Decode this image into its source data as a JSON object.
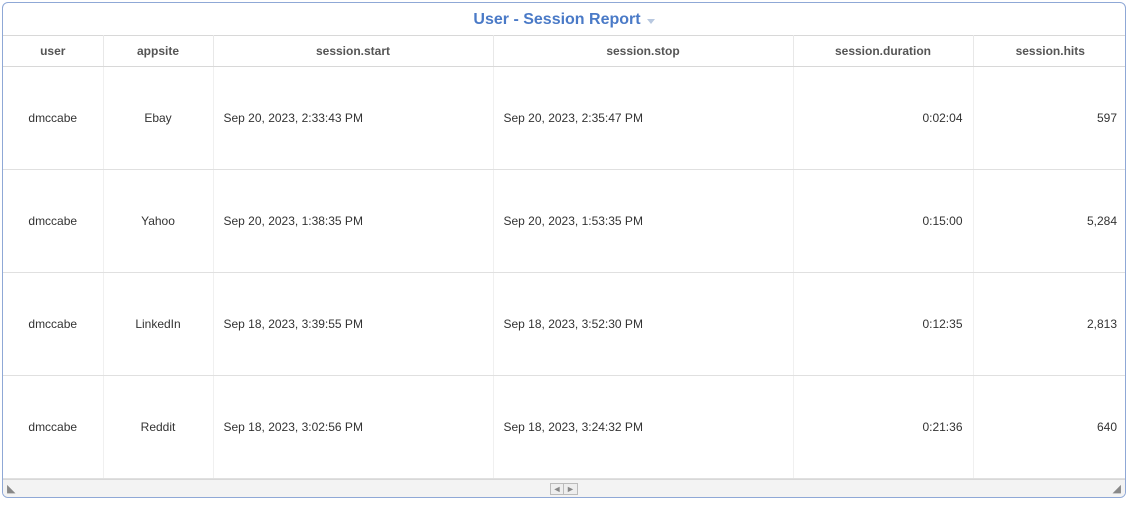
{
  "header": {
    "title": "User - Session Report"
  },
  "columns": {
    "user": "user",
    "appsite": "appsite",
    "start": "session.start",
    "stop": "session.stop",
    "duration": "session.duration",
    "hits": "session.hits"
  },
  "rows": [
    {
      "user": "dmccabe",
      "appsite": "Ebay",
      "start": "Sep 20, 2023, 2:33:43 PM",
      "stop": "Sep 20, 2023, 2:35:47 PM",
      "duration": "0:02:04",
      "hits": "597"
    },
    {
      "user": "dmccabe",
      "appsite": "Yahoo",
      "start": "Sep 20, 2023, 1:38:35 PM",
      "stop": "Sep 20, 2023, 1:53:35 PM",
      "duration": "0:15:00",
      "hits": "5,284"
    },
    {
      "user": "dmccabe",
      "appsite": "LinkedIn",
      "start": "Sep 18, 2023, 3:39:55 PM",
      "stop": "Sep 18, 2023, 3:52:30 PM",
      "duration": "0:12:35",
      "hits": "2,813"
    },
    {
      "user": "dmccabe",
      "appsite": "Reddit",
      "start": "Sep 18, 2023, 3:02:56 PM",
      "stop": "Sep 18, 2023, 3:24:32 PM",
      "duration": "0:21:36",
      "hits": "640"
    }
  ]
}
